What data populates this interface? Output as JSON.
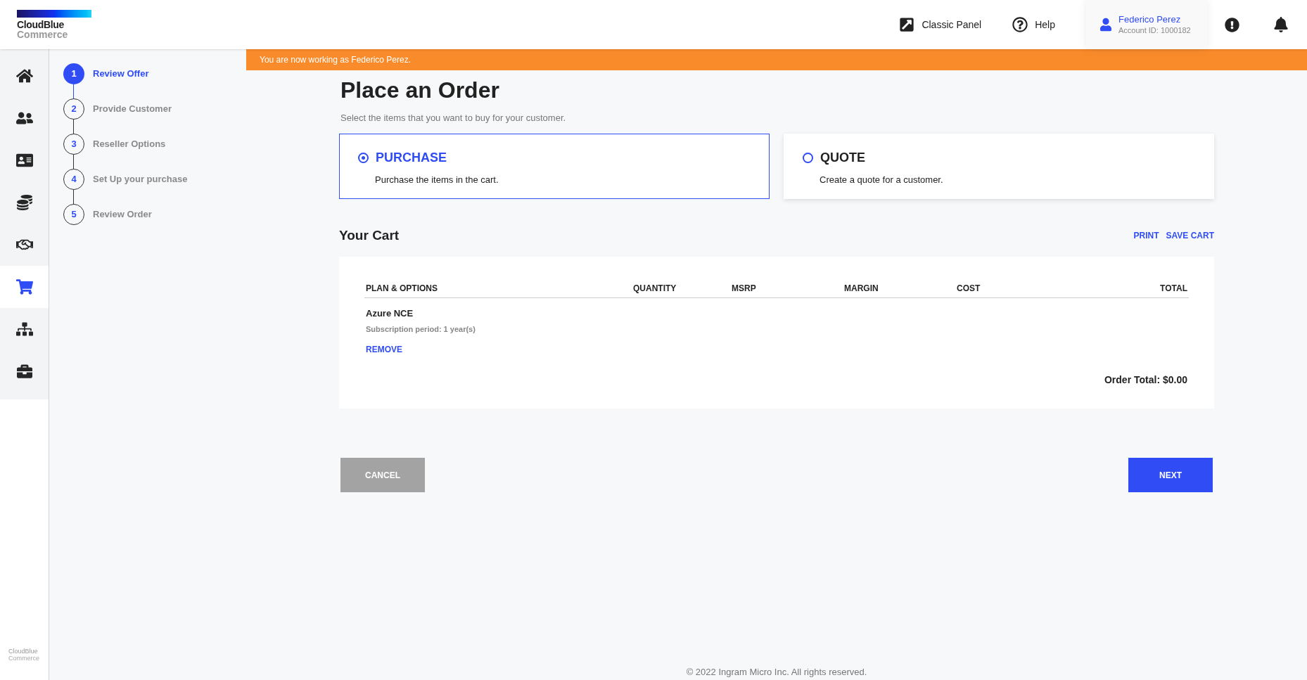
{
  "logo": {
    "line1": "CloudBlue",
    "line2": "Commerce"
  },
  "header": {
    "links": [
      {
        "kind": "classic",
        "label": "Classic Panel"
      },
      {
        "kind": "help",
        "label": "Help"
      }
    ],
    "user": {
      "name": "Federico Perez",
      "account": "Account ID: 1000182"
    }
  },
  "banner": "You are now working as Federico Perez.",
  "nav": [
    {
      "kind": "home",
      "selected": false
    },
    {
      "kind": "customers",
      "selected": false
    },
    {
      "kind": "card",
      "selected": false
    },
    {
      "kind": "coins",
      "selected": false
    },
    {
      "kind": "handshake",
      "selected": false
    },
    {
      "kind": "cart",
      "selected": true
    },
    {
      "kind": "hierarchy",
      "selected": false
    },
    {
      "kind": "briefcase",
      "selected": false
    }
  ],
  "footer_logo": {
    "line1": "CloudBlue",
    "line2": "Commerce"
  },
  "steps": [
    {
      "number": "1",
      "label": "Review Offer",
      "selected": true
    },
    {
      "number": "2",
      "label": "Provide Customer",
      "selected": false
    },
    {
      "number": "3",
      "label": "Reseller Options",
      "selected": false
    },
    {
      "number": "4",
      "label": "Set Up your purchase",
      "selected": false
    },
    {
      "number": "5",
      "label": "Review Order",
      "selected": false
    }
  ],
  "page": {
    "title": "Place an Order",
    "subtitle": "Select the items that you want to buy for your customer."
  },
  "order_types": [
    {
      "title": "PURCHASE",
      "description": "Purchase the items in the cart.",
      "selected": true
    },
    {
      "title": "QUOTE",
      "description": "Create a quote for a customer.",
      "selected": false
    }
  ],
  "cart": {
    "title": "Your Cart",
    "actions": [
      "PRINT",
      "SAVE CART"
    ],
    "columns": [
      "PLAN & OPTIONS",
      "QUANTITY",
      "MSRP",
      "MARGIN",
      "COST",
      "TOTAL"
    ],
    "items": [
      {
        "name": "Azure NCE",
        "detail": "Subscription period: 1 year(s)",
        "remove": "REMOVE"
      }
    ],
    "order_total": "Order Total: $0.00"
  },
  "buttons": {
    "cancel": "CANCEL",
    "next": "NEXT"
  },
  "copyright": "© 2022 Ingram Micro Inc. All rights reserved."
}
